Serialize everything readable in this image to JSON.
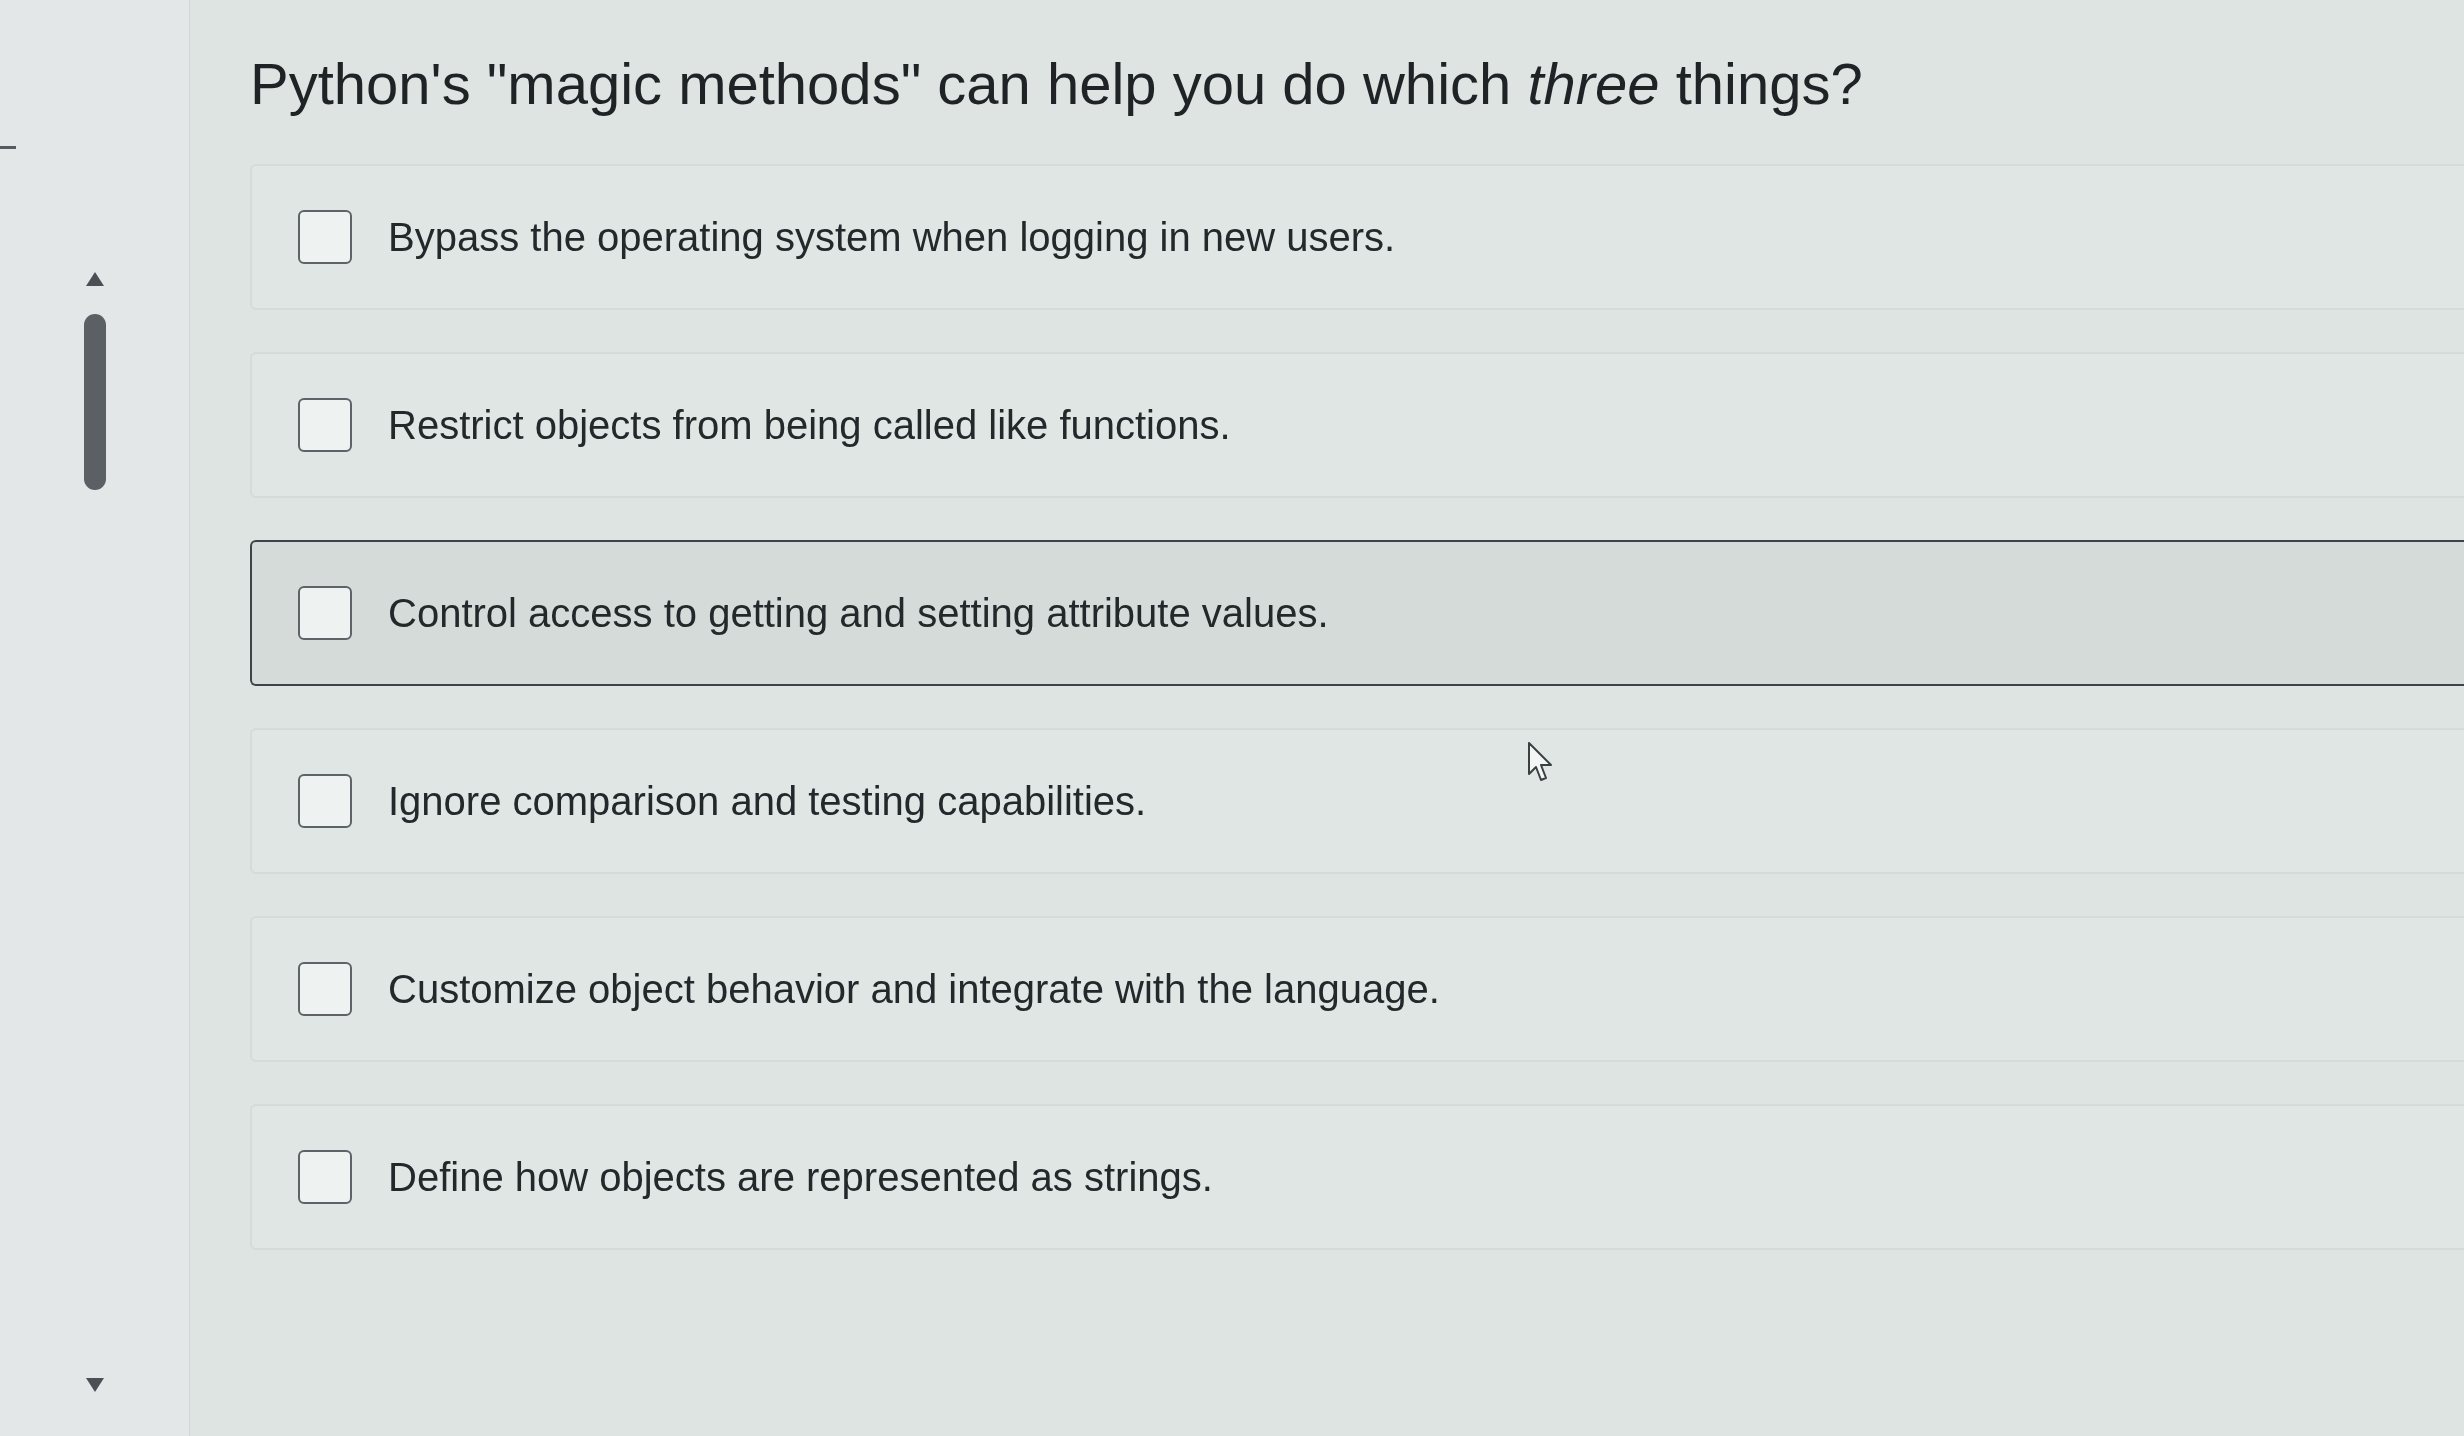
{
  "question": {
    "title": "Python's \"magic methods\" can help you do which *three* things?"
  },
  "options": [
    {
      "label": "Bypass the operating system when logging in new users.",
      "checked": false,
      "hovered": false
    },
    {
      "label": "Restrict objects from being called like functions.",
      "checked": false,
      "hovered": false
    },
    {
      "label": "Control access to getting and setting attribute values.",
      "checked": false,
      "hovered": true
    },
    {
      "label": "Ignore comparison and testing capabilities.",
      "checked": false,
      "hovered": false
    },
    {
      "label": "Customize object behavior and integrate with the language.",
      "checked": false,
      "hovered": false
    },
    {
      "label": "Define how objects are represented as strings.",
      "checked": false,
      "hovered": false
    }
  ]
}
